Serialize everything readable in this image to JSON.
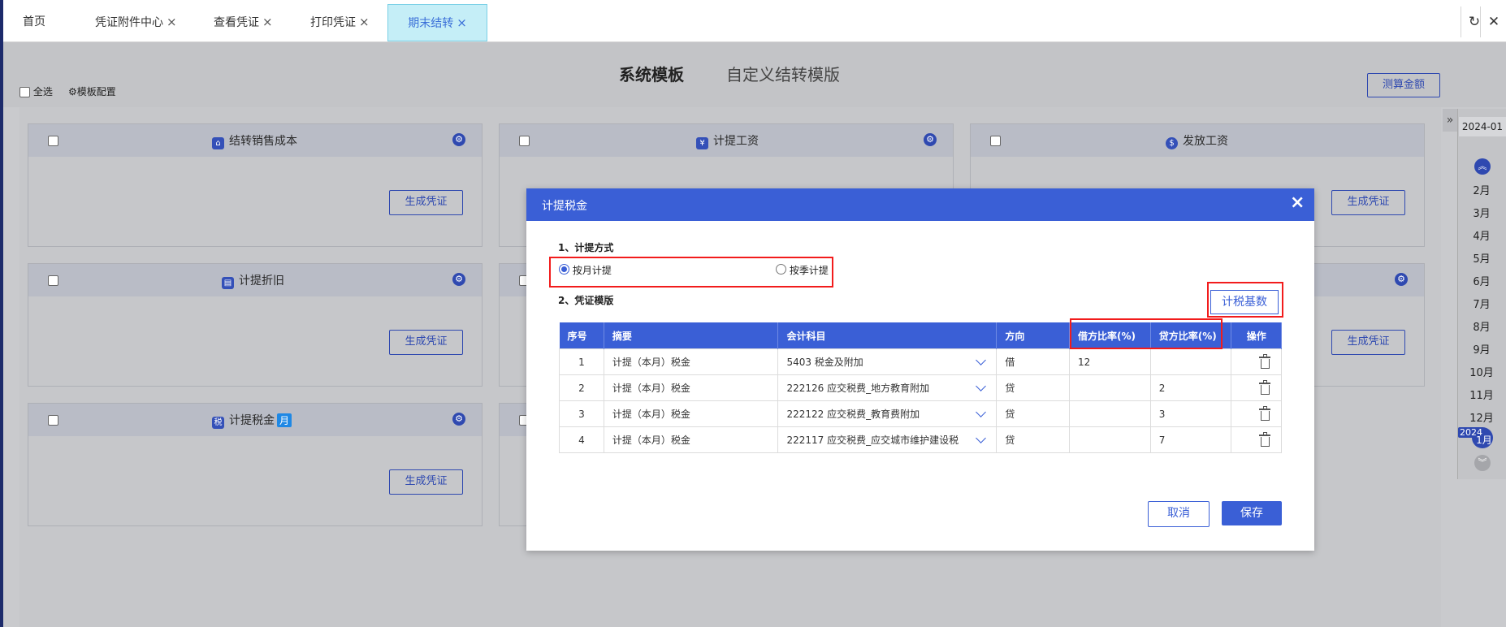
{
  "tabs": [
    {
      "label": "首页"
    },
    {
      "label": "凭证附件中心"
    },
    {
      "label": "查看凭证"
    },
    {
      "label": "打印凭证"
    },
    {
      "label": "期末结转"
    }
  ],
  "tab_close": "×",
  "toolbar": {
    "refresh_glyph": "↻",
    "close_glyph": "✕"
  },
  "header": {
    "tab_system": "系统模板",
    "tab_custom": "自定义结转模版",
    "select_all": "全选",
    "template_config": "模板配置",
    "calc_button": "测算金额"
  },
  "cards": [
    {
      "title": "结转销售成本",
      "button": "生成凭证",
      "icon": "house-icon"
    },
    {
      "title": "计提工资",
      "button": "",
      "icon": "money-bag-icon"
    },
    {
      "title": "发放工资",
      "button": "生成凭证",
      "icon": "wallet-icon"
    },
    {
      "title": "计提折旧",
      "button": "生成凭证",
      "icon": "depreciation-icon"
    },
    {
      "title": "",
      "button": "生成凭证",
      "icon": "gear-icon"
    },
    {
      "title": "计提税金",
      "badge": "月",
      "button": "生成凭证",
      "icon": "tax-icon"
    }
  ],
  "timeline": {
    "year_top": "2024-01",
    "months": [
      "2月",
      "3月",
      "4月",
      "5月",
      "6月",
      "7月",
      "8月",
      "9月",
      "10月",
      "11月",
      "12月"
    ],
    "year_bottom": "2024",
    "current_month": "1月",
    "collapse_glyph": "»"
  },
  "modal": {
    "title": "计提税金",
    "close": "×",
    "section1": "1、计提方式",
    "option_monthly": "按月计提",
    "option_quarterly": "按季计提",
    "selected_option": "按月计提",
    "section2": "2、凭证模版",
    "tax_base_button": "计税基数",
    "columns": [
      "序号",
      "摘要",
      "会计科目",
      "方向",
      "借方比率(%)",
      "贷方比率(%)",
      "操作"
    ],
    "rows": [
      {
        "no": "1",
        "summary": "计提（本月）税金",
        "account": "5403 税金及附加",
        "direction": "借",
        "debit": "12",
        "credit": ""
      },
      {
        "no": "2",
        "summary": "计提（本月）税金",
        "account": "222126 应交税费_地方教育附加",
        "direction": "贷",
        "debit": "",
        "credit": "2"
      },
      {
        "no": "3",
        "summary": "计提（本月）税金",
        "account": "222122 应交税费_教育费附加",
        "direction": "贷",
        "debit": "",
        "credit": "3"
      },
      {
        "no": "4",
        "summary": "计提（本月）税金",
        "account": "222117 应交税费_应交城市维护建设税",
        "direction": "贷",
        "debit": "",
        "credit": "7"
      }
    ],
    "cancel": "取消",
    "save": "保存"
  },
  "colors": {
    "accent": "#3a5fd6",
    "highlight": "#f21c1c",
    "active_tab": "#c5eef7"
  }
}
